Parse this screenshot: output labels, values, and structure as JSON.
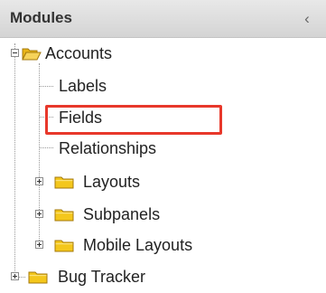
{
  "header": {
    "title": "Modules",
    "collapse_glyph": "‹"
  },
  "tree": {
    "accounts": {
      "label": "Accounts",
      "expanded": true,
      "children": {
        "labels": "Labels",
        "fields": "Fields",
        "relationships": "Relationships",
        "layouts": "Layouts",
        "subpanels": "Subpanels",
        "mobile_layouts": "Mobile Layouts"
      }
    },
    "bug_tracker": {
      "label": "Bug Tracker",
      "expanded": false
    }
  },
  "highlight": {
    "target": "Fields",
    "color": "#e8382b"
  },
  "colors": {
    "folder": "#f0c419",
    "folder_outline": "#b8860b",
    "header_bg": "#dcdcdc"
  }
}
